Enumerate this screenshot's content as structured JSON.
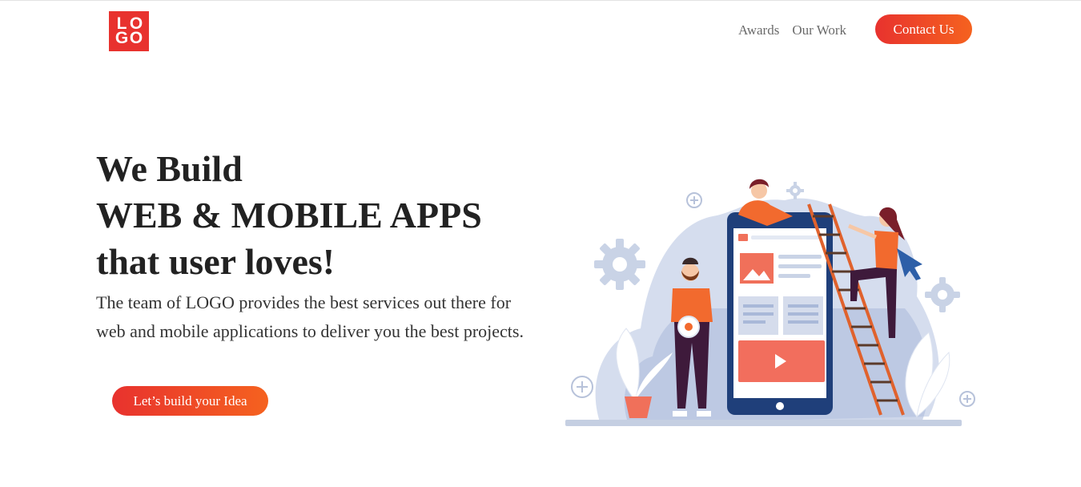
{
  "header": {
    "logo_letters": [
      "L",
      "O",
      "G",
      "O"
    ],
    "nav": [
      {
        "label": "Awards"
      },
      {
        "label": "Our Work"
      }
    ],
    "contact_label": "Contact Us"
  },
  "hero": {
    "title_lines": [
      "We Build",
      "WEB & MOBILE APPS",
      "that user loves!"
    ],
    "description": "The team of LOGO provides the best services out there for web and mobile applications to deliver you the best projects.",
    "cta_label": "Let’s build your Idea"
  },
  "illustration": {
    "icons": [
      "gear-icon",
      "plus-icon",
      "image-icon",
      "play-icon",
      "search-icon",
      "arrow-cursor-icon",
      "plant-icon",
      "ladder"
    ]
  },
  "colors": {
    "brand_red": "#e8322e",
    "brand_orange": "#f5621f",
    "text_dark": "#222222",
    "nav_gray": "#6b6b6b",
    "illustration_blue": "#a9b8d8",
    "phone_navy": "#1f3f7a"
  }
}
